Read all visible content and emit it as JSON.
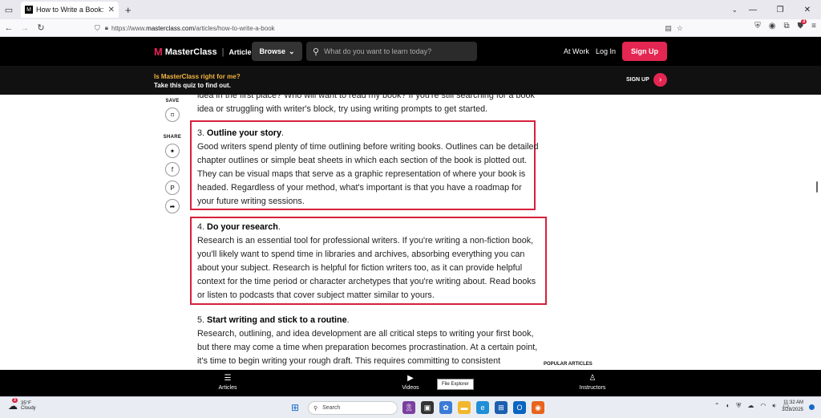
{
  "browser": {
    "tab_title": "How to Write a Book: Complete",
    "favicon_letter": "M",
    "url_prefix": "https://www.",
    "url_host": "masterclass.com",
    "url_path": "/articles/how-to-write-a-book"
  },
  "header": {
    "brand": "MasterClass",
    "section": "Articles",
    "browse_label": "Browse",
    "search_placeholder": "What do you want to learn today?",
    "at_work": "At Work",
    "log_in": "Log In",
    "sign_up": "Sign Up"
  },
  "promo": {
    "question": "Is MasterClass right for me?",
    "subtext": "Take this quiz to find out.",
    "cta": "SIGN UP"
  },
  "sidebar": {
    "save_label": "SAVE",
    "share_label": "SHARE",
    "share_icons": [
      "twitter-icon",
      "facebook-icon",
      "pinterest-icon",
      "share-arrow-icon"
    ]
  },
  "article": {
    "intro_line1": "idea in the first place? Who will want to read my book? If you're still searching for a book",
    "intro_line2": "idea or struggling with writer's block, try using writing prompts to get started.",
    "step3_num": "3. ",
    "step3_title": "Outline your story",
    "step3_body": "Good writers spend plenty of time outlining before writing books. Outlines can be detailed chapter outlines or simple beat sheets in which each section of the book is plotted out. They can be visual maps that serve as a graphic representation of where your book is headed. Regardless of your method, what's important is that you have a roadmap for your future writing sessions.",
    "step4_num": "4. ",
    "step4_title": "Do your research",
    "step4_body": "Research is an essential tool for professional writers. If you're writing a non-fiction book, you'll likely want to spend time in libraries and archives, absorbing everything you can about your subject. Research is helpful for fiction writers too, as it can provide helpful context for the time period or character archetypes that you're writing about. Read books or listen to podcasts that cover subject matter similar to yours.",
    "step5_num": "5. ",
    "step5_title": "Start writing and stick to a routine",
    "step5_body": "Research, outlining, and idea development are all critical steps to writing your first book, but there may come a time when preparation becomes procrastination. At a certain point, it's time to begin writing your rough draft. This requires committing to consistent",
    "popular": "POPULAR ARTICLES"
  },
  "bottom_nav": {
    "articles": "Articles",
    "videos": "Videos",
    "instructors": "Instructors"
  },
  "tooltip": "File Explorer",
  "taskbar": {
    "temp": "35°F",
    "condition": "Cloudy",
    "weather_badge": "3",
    "search_placeholder": "Search",
    "time": "11:32 AM",
    "date": "3/28/2025"
  }
}
